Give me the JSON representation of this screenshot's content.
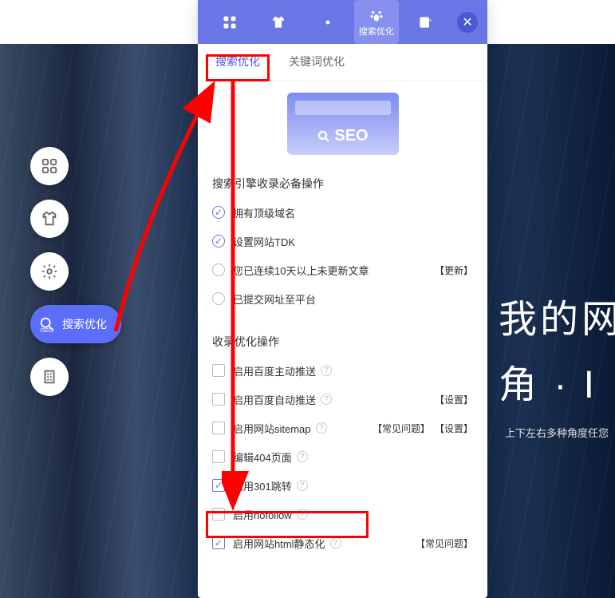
{
  "background": {
    "title_line1": "我的网",
    "title_line2": "角 · I",
    "subtitle": "上下左右多种角度任您"
  },
  "float_buttons": {
    "seo_label": "搜索优化"
  },
  "toolbar": {
    "active_label": "搜索优化"
  },
  "tabs": [
    {
      "label": "搜索优化",
      "active": true
    },
    {
      "label": "关键词优化",
      "active": false
    }
  ],
  "seo_box": {
    "text": "SEO"
  },
  "section1": {
    "title": "搜索引擎收录必备操作",
    "rows": [
      {
        "checked": true,
        "label": "拥有顶级域名",
        "help": false,
        "actions": []
      },
      {
        "checked": true,
        "label": "设置网站TDK",
        "help": false,
        "actions": []
      },
      {
        "checked": false,
        "label": "您已连续10天以上未更新文章",
        "help": false,
        "actions": [
          "【更新】"
        ]
      },
      {
        "checked": false,
        "label": "已提交网址至平台",
        "help": false,
        "actions": []
      }
    ]
  },
  "section2": {
    "title": "收录优化操作",
    "rows": [
      {
        "checked": false,
        "label": "启用百度主动推送",
        "help": true,
        "actions": []
      },
      {
        "checked": false,
        "label": "启用百度自动推送",
        "help": true,
        "actions": [
          "【设置】"
        ]
      },
      {
        "checked": false,
        "label": "启用网站sitemap",
        "help": true,
        "actions": [
          "【常见问题】",
          "【设置】"
        ]
      },
      {
        "checked": false,
        "label": "编辑404页面",
        "help": true,
        "actions": []
      },
      {
        "checked": true,
        "label": "启用301跳转",
        "help": true,
        "actions": [],
        "highlight": true
      },
      {
        "checked": false,
        "label": "启用nofollow",
        "help": true,
        "actions": []
      },
      {
        "checked": true,
        "label": "启用网站html静态化",
        "help": true,
        "actions": [
          "【常见问题】"
        ]
      }
    ]
  }
}
